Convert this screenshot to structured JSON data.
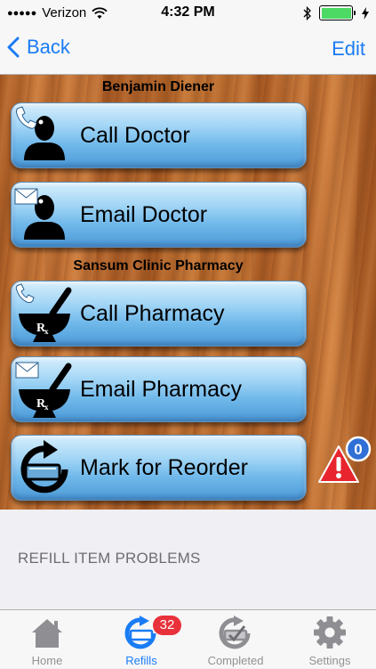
{
  "status_bar": {
    "carrier": "Verizon",
    "time": "4:32 PM",
    "signal_icon": "signal-dots-icon",
    "wifi_icon": "wifi-icon",
    "bluetooth_icon": "bluetooth-icon",
    "battery_icon": "battery-icon"
  },
  "nav": {
    "back_label": "Back",
    "edit_label": "Edit",
    "accent_color": "#1a7cf4"
  },
  "doctor": {
    "name": "Benjamin Diener",
    "call_label": "Call Doctor",
    "email_label": "Email Doctor"
  },
  "pharmacy": {
    "name": "Sansum Clinic Pharmacy",
    "call_label": "Call Pharmacy",
    "email_label": "Email Pharmacy"
  },
  "reorder": {
    "label": "Mark for Reorder"
  },
  "alert": {
    "count": "0",
    "icon": "warning-icon"
  },
  "problems": {
    "heading": "REFILL ITEM PROBLEMS"
  },
  "tabs": [
    {
      "label": "Home",
      "icon": "home-icon"
    },
    {
      "label": "Refills",
      "icon": "refills-icon",
      "badge": "32"
    },
    {
      "label": "Completed",
      "icon": "completed-icon"
    },
    {
      "label": "Settings",
      "icon": "gear-icon"
    }
  ]
}
